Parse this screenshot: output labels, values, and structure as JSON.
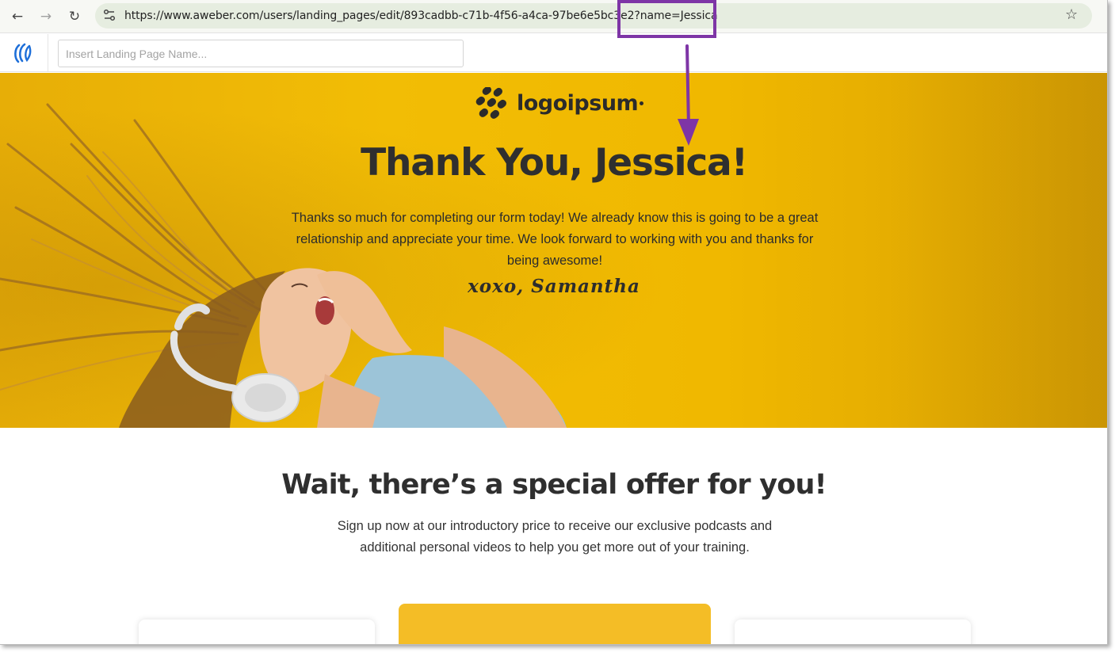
{
  "browser": {
    "url": "https://www.aweber.com/users/landing_pages/edit/893cadbb-c71b-4f56-a4ca-97be6e5bc3e2?name=Jessica",
    "icons": [
      "back-arrow-icon",
      "forward-arrow-icon",
      "reload-icon",
      "site-settings-icon",
      "bookmark-star-icon"
    ]
  },
  "editor": {
    "name_placeholder": "Insert Landing Page Name...",
    "name_value": ""
  },
  "hero": {
    "logo_text": "logoipsum",
    "title": "Thank You, Jessica!",
    "body": "Thanks so much for completing our form today! We already know this is going to be a great relationship and appreciate your time. We look forward to working with you and thanks for being awesome!",
    "signature": "xoxo, Samantha"
  },
  "offer": {
    "title": "Wait, there’s a special offer for you!",
    "body": "Sign up now at our introductory price to receive our exclusive podcasts and additional personal videos to help you get more out of your training."
  },
  "colors": {
    "hero_yellow": "#f0b800",
    "annotation_purple": "#7e35a6",
    "featured_card": "#f4bd26",
    "aweber_blue": "#1e6fd9"
  }
}
